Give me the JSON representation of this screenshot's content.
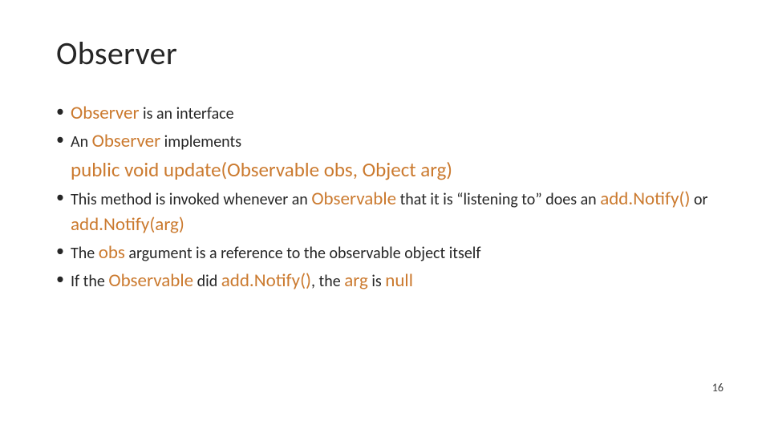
{
  "title": "Observer",
  "bullets": {
    "b1": {
      "kw": "Observer",
      "rest": " is an interface"
    },
    "b2": {
      "pre": "An ",
      "kw": "Observer",
      "post": " implements",
      "sig": "public void update(Observable obs, Object arg)"
    },
    "b3": {
      "p1": "This method is invoked whenever an ",
      "kw1": "Observable",
      "p2": " that it is “listening to” does an ",
      "kw2": "add.Notify()",
      "p3": " or ",
      "kw3": "add.Notify(arg)"
    },
    "b4": {
      "p1": "The ",
      "kw": "obs",
      "p2": " argument is a reference to the observable object itself"
    },
    "b5": {
      "p1": "If the ",
      "kw1": "Observable",
      "p2": " did ",
      "kw2": "add.Notify()",
      "p3": ", the ",
      "kw3": "arg",
      "p4": " is ",
      "kw4": "null"
    }
  },
  "pageNumber": "16"
}
